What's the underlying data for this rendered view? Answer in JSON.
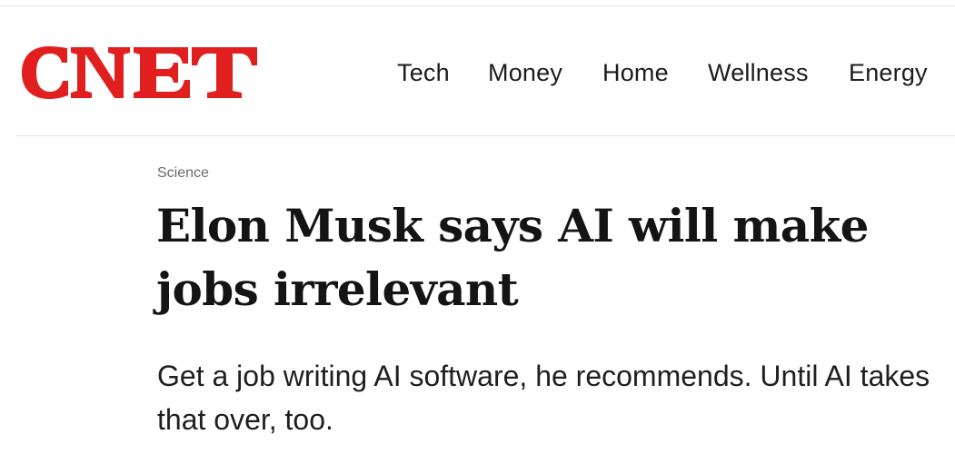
{
  "brand": {
    "name": "CNET",
    "color": "#e11f1f"
  },
  "nav": {
    "items": [
      {
        "label": "Tech"
      },
      {
        "label": "Money"
      },
      {
        "label": "Home"
      },
      {
        "label": "Wellness"
      },
      {
        "label": "Energy"
      }
    ]
  },
  "article": {
    "category": "Science",
    "headline": "Elon Musk says AI will make jobs irrelevant",
    "dek": "Get a job writing AI software, he recommends. Until AI takes that over, too."
  }
}
